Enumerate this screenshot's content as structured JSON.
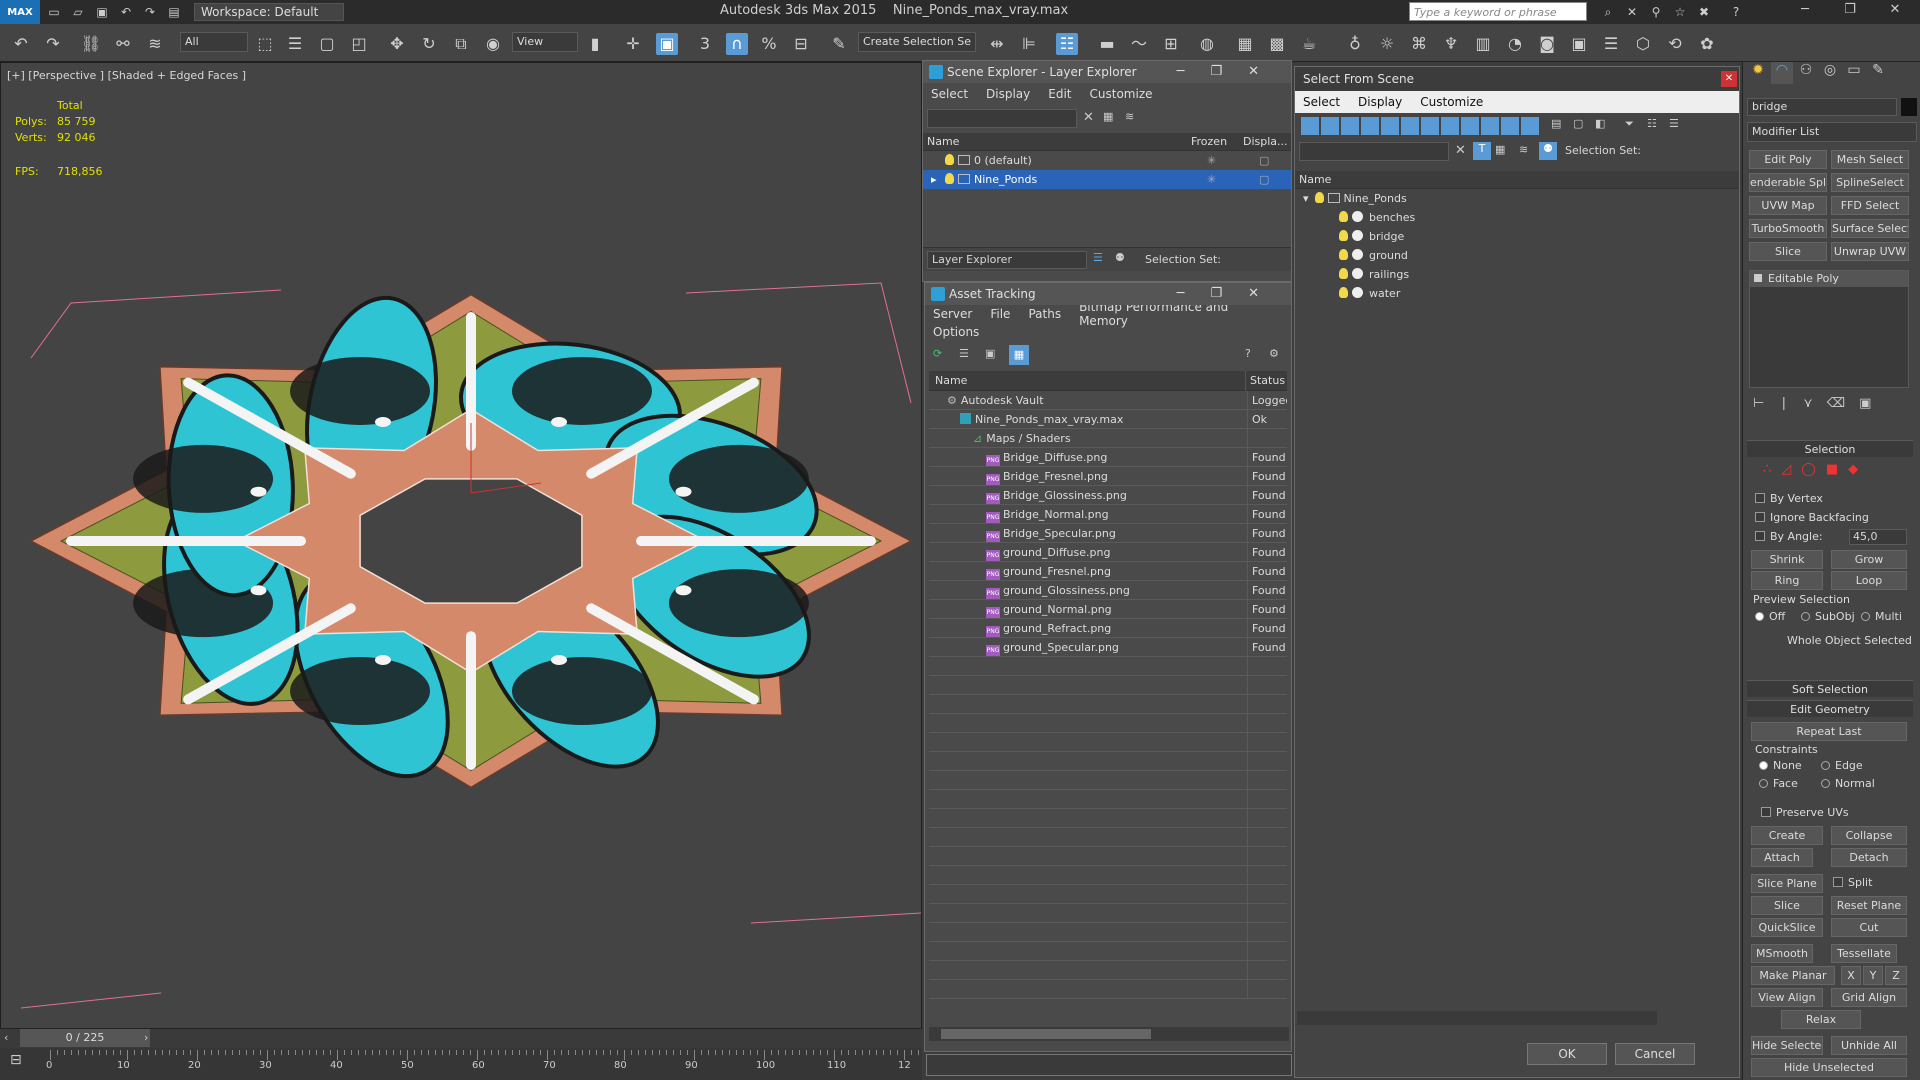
{
  "titlebar": {
    "logo": "MAX",
    "workspace": "Workspace: Default",
    "app_title": "Autodesk 3ds Max  2015",
    "file_title": "Nine_Ponds_max_vray.max",
    "search_placeholder": "Type a keyword or phrase"
  },
  "toolbar": {
    "selection_filter": "All",
    "ref_coord": "View",
    "named_selection": "Create Selection Se",
    "snap_label": "3"
  },
  "viewport": {
    "label": "[+] [Perspective ] [Shaded + Edged Faces ]",
    "stats_total": "Total",
    "polys_label": "Polys:",
    "polys_value": "85 759",
    "verts_label": "Verts:",
    "verts_value": "92 046",
    "fps_label": "FPS:",
    "fps_value": "718,856",
    "colors": {
      "terracotta": "#d4896b",
      "water": "#2fc4d4",
      "grass": "#8d9a3e",
      "dark": "#1a1a1a",
      "frame": "#e0709a"
    }
  },
  "timeline": {
    "slider": "0 / 225",
    "ticks": [
      "0",
      "10",
      "20",
      "30",
      "40",
      "50",
      "60",
      "70",
      "80",
      "90",
      "100",
      "110",
      "12"
    ]
  },
  "scene_explorer": {
    "title": "Scene Explorer - Layer Explorer",
    "menus": [
      "Select",
      "Display",
      "Edit",
      "Customize"
    ],
    "columns": [
      "Name",
      "Frozen",
      "Displa..."
    ],
    "layers": [
      {
        "name": "0 (default)",
        "selected": false
      },
      {
        "name": "Nine_Ponds",
        "selected": true
      }
    ],
    "footer_dropdown": "Layer Explorer",
    "footer_selset": "Selection Set:"
  },
  "asset_tracking": {
    "title": "Asset Tracking",
    "menus": [
      "Server",
      "File",
      "Paths",
      "Bitmap Performance and Memory"
    ],
    "menus2": [
      "Options"
    ],
    "columns": [
      "Name",
      "Status"
    ],
    "rows": [
      {
        "name": "Autodesk Vault",
        "status": "Logged",
        "indent": 0,
        "kind": "vault"
      },
      {
        "name": "Nine_Ponds_max_vray.max",
        "status": "Ok",
        "indent": 1,
        "kind": "max"
      },
      {
        "name": "Maps / Shaders",
        "status": "",
        "indent": 2,
        "kind": "folder"
      },
      {
        "name": "Bridge_Diffuse.png",
        "status": "Found",
        "indent": 3,
        "kind": "png"
      },
      {
        "name": "Bridge_Fresnel.png",
        "status": "Found",
        "indent": 3,
        "kind": "png"
      },
      {
        "name": "Bridge_Glossiness.png",
        "status": "Found",
        "indent": 3,
        "kind": "png"
      },
      {
        "name": "Bridge_Normal.png",
        "status": "Found",
        "indent": 3,
        "kind": "png"
      },
      {
        "name": "Bridge_Specular.png",
        "status": "Found",
        "indent": 3,
        "kind": "png"
      },
      {
        "name": "ground_Diffuse.png",
        "status": "Found",
        "indent": 3,
        "kind": "png"
      },
      {
        "name": "ground_Fresnel.png",
        "status": "Found",
        "indent": 3,
        "kind": "png"
      },
      {
        "name": "ground_Glossiness.png",
        "status": "Found",
        "indent": 3,
        "kind": "png"
      },
      {
        "name": "ground_Normal.png",
        "status": "Found",
        "indent": 3,
        "kind": "png"
      },
      {
        "name": "ground_Refract.png",
        "status": "Found",
        "indent": 3,
        "kind": "png"
      },
      {
        "name": "ground_Specular.png",
        "status": "Found",
        "indent": 3,
        "kind": "png"
      }
    ]
  },
  "select_from_scene": {
    "title": "Select From Scene",
    "menus": [
      "Select",
      "Display",
      "Customize"
    ],
    "selset": "Selection Set:",
    "column": "Name",
    "root": "Nine_Ponds",
    "objects": [
      "benches",
      "bridge",
      "ground",
      "railings",
      "water"
    ],
    "ok": "OK",
    "cancel": "Cancel"
  },
  "command_panel": {
    "object_name": "bridge",
    "modifier_list": "Modifier List",
    "modifier_buttons": [
      "Edit Poly",
      "Mesh Select",
      "enderable Splir",
      "SplineSelect",
      "UVW Map",
      "FFD Select",
      "TurboSmooth",
      "Surface Select",
      "Slice",
      "Unwrap UVW"
    ],
    "stack_item": "Editable Poly",
    "selection_rollout": "Selection",
    "by_vertex": "By Vertex",
    "ignore_backfacing": "Ignore Backfacing",
    "by_angle": "By Angle:",
    "angle_value": "45,0",
    "shrink": "Shrink",
    "grow": "Grow",
    "ring": "Ring",
    "loop": "Loop",
    "preview_selection": "Preview Selection",
    "preview_off": "Off",
    "preview_subobj": "SubObj",
    "preview_multi": "Multi",
    "whole_object": "Whole Object Selected",
    "soft_selection": "Soft Selection",
    "edit_geometry": "Edit Geometry",
    "repeat_last": "Repeat Last",
    "constraints": "Constraints",
    "c_none": "None",
    "c_edge": "Edge",
    "c_face": "Face",
    "c_normal": "Normal",
    "preserve_uvs": "Preserve UVs",
    "create": "Create",
    "collapse": "Collapse",
    "attach": "Attach",
    "detach": "Detach",
    "slice_plane": "Slice Plane",
    "split": "Split",
    "slice": "Slice",
    "reset_plane": "Reset Plane",
    "quickslice": "QuickSlice",
    "cut": "Cut",
    "msmooth": "MSmooth",
    "tessellate": "Tessellate",
    "make_planar": "Make Planar",
    "x": "X",
    "y": "Y",
    "z": "Z",
    "view_align": "View Align",
    "grid_align": "Grid Align",
    "relax": "Relax",
    "hide_selected": "Hide Selected",
    "unhide_all": "Unhide All",
    "hide_unselected": "Hide Unselected"
  }
}
